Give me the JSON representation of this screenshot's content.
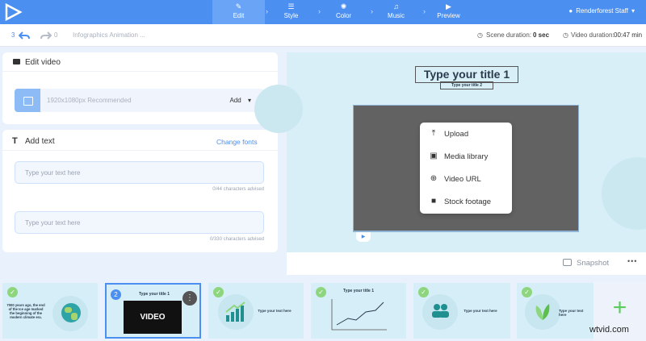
{
  "nav": {
    "steps": [
      {
        "icon": "✎",
        "label": "Edit"
      },
      {
        "icon": "☰",
        "label": "Style"
      },
      {
        "icon": "✺",
        "label": "Color"
      },
      {
        "icon": "♫",
        "label": "Music"
      },
      {
        "icon": "▶",
        "label": "Preview"
      }
    ],
    "user": "Renderforest Staff"
  },
  "toolbar": {
    "undo_count": "3",
    "redo_count": "0",
    "project_name": "Infographics Animation ...",
    "scene_duration_label": "Scene duration:",
    "scene_duration_value": "0 sec",
    "video_duration_label": "Video duration:",
    "video_duration_value": "00:47 min"
  },
  "edit_video": {
    "title": "Edit video",
    "recommended": "1920x1080px Recommended",
    "add_label": "Add"
  },
  "add_text": {
    "title": "Add text",
    "change_fonts": "Change fonts",
    "fields": [
      {
        "placeholder": "Type your text here",
        "hint": "0/44 characters advised"
      },
      {
        "placeholder": "Type your text here",
        "hint": "0/330 characters advised"
      }
    ]
  },
  "preview": {
    "title1": "Type your title 1",
    "title2": "Type your title 2",
    "menu": [
      {
        "icon": "⤒",
        "label": "Upload"
      },
      {
        "icon": "▣",
        "label": "Media library"
      },
      {
        "icon": "⊕",
        "label": "Video URL"
      },
      {
        "icon": "■",
        "label": "Stock footage"
      }
    ],
    "snapshot_label": "Snapshot",
    "more_label": "•••"
  },
  "scenes": {
    "scene1_text": "7000 years ago, the end of the Ice age marked the beginning of the modern climate era.",
    "scene2_number": "2",
    "scene2_title": "Type your title 1",
    "scene2_video": "VIDEO",
    "scene3_text": "Type your text here",
    "scene4_title": "Type your title 1",
    "scene5_text": "Type your text here",
    "scene6_text": "Type your text here",
    "add_label": "+"
  },
  "watermark": "wtvid.com",
  "colors": {
    "primary": "#4b8ff0",
    "check": "#8ed67e",
    "add": "#5ccb5f"
  }
}
